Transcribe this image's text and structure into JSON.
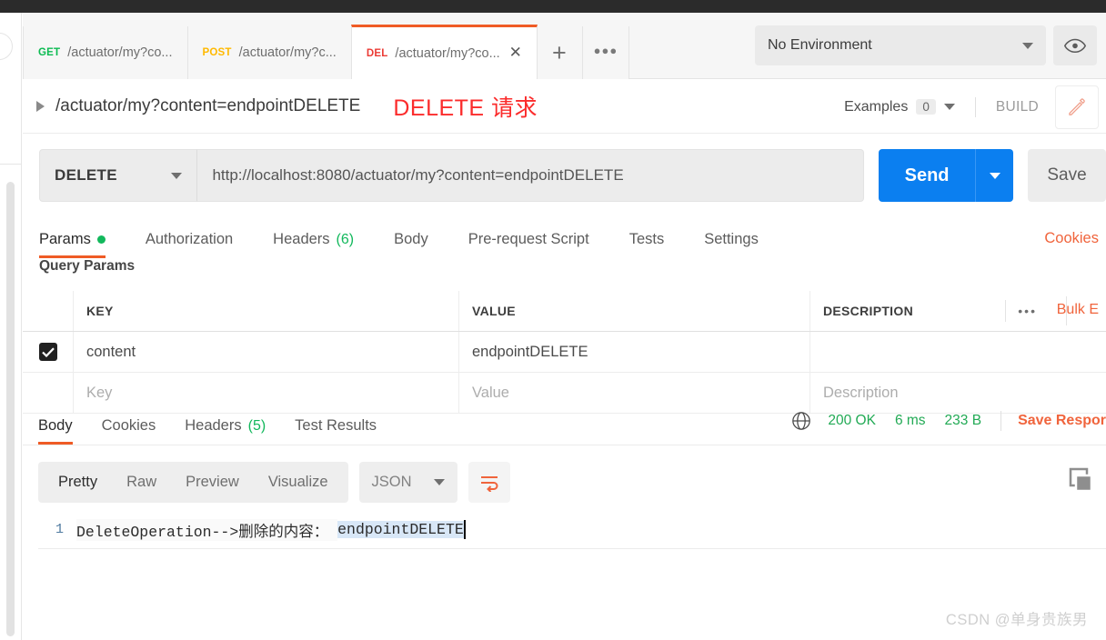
{
  "window": {
    "titlebar": ""
  },
  "tabstrip": {
    "tabs": [
      {
        "verb": "GET",
        "name": "/actuator/my?co...",
        "active": false
      },
      {
        "verb": "POST",
        "name": "/actuator/my?c...",
        "active": false
      },
      {
        "verb": "DEL",
        "name": "/actuator/my?co...",
        "active": true,
        "close": "✕"
      }
    ],
    "new_tab": "+",
    "more_tabs": "●●●",
    "environment": {
      "label": "No Environment"
    },
    "eye_icon": "eye-icon"
  },
  "request_title": {
    "path": "/actuator/my?content=endpointDELETE",
    "annotation": "DELETE 请求",
    "examples_label": "Examples",
    "examples_count": "0",
    "build_label": "BUILD",
    "edit_icon": "pencil-icon"
  },
  "urlbar": {
    "method": "DELETE",
    "url": "http://localhost:8080/actuator/my?content=endpointDELETE",
    "send_label": "Send",
    "save_label": "Save"
  },
  "request_tabs": {
    "items": [
      {
        "label": "Params",
        "active": true,
        "dot": true
      },
      {
        "label": "Authorization",
        "active": false
      },
      {
        "label": "Headers",
        "active": false,
        "count": "(6)"
      },
      {
        "label": "Body",
        "active": false
      },
      {
        "label": "Pre-request Script",
        "active": false
      },
      {
        "label": "Tests",
        "active": false
      },
      {
        "label": "Settings",
        "active": false
      }
    ],
    "cookies_link": "Cookies"
  },
  "query_params": {
    "section_label": "Query Params",
    "bulk_edit_label": "Bulk E",
    "more_icon": "•••",
    "headers": {
      "key": "KEY",
      "value": "VALUE",
      "description": "DESCRIPTION"
    },
    "rows": [
      {
        "checked": true,
        "key": "content",
        "value": "endpointDELETE",
        "description": ""
      }
    ],
    "placeholder_row": {
      "key": "Key",
      "value": "Value",
      "description": "Description"
    }
  },
  "response": {
    "tabs": [
      {
        "label": "Body",
        "active": true
      },
      {
        "label": "Cookies",
        "active": false
      },
      {
        "label": "Headers",
        "active": false,
        "count": "(5)"
      },
      {
        "label": "Test Results",
        "active": false
      }
    ],
    "status": "200 OK",
    "time": "6 ms",
    "size": "233 B",
    "save_response": "Save Respor",
    "globe_icon": "globe-icon",
    "viewbar": {
      "modes": [
        {
          "label": "Pretty",
          "active": true
        },
        {
          "label": "Raw",
          "active": false
        },
        {
          "label": "Preview",
          "active": false
        },
        {
          "label": "Visualize",
          "active": false
        }
      ],
      "format": "JSON",
      "wrap_icon": "wrap-lines-icon",
      "copy_icon": "copy-icon"
    },
    "body": {
      "line_number": "1",
      "text_plain": "DeleteOperation-->删除的内容： ",
      "text_selected": "endpointDELETE"
    }
  },
  "watermark": "CSDN @单身贵族男"
}
